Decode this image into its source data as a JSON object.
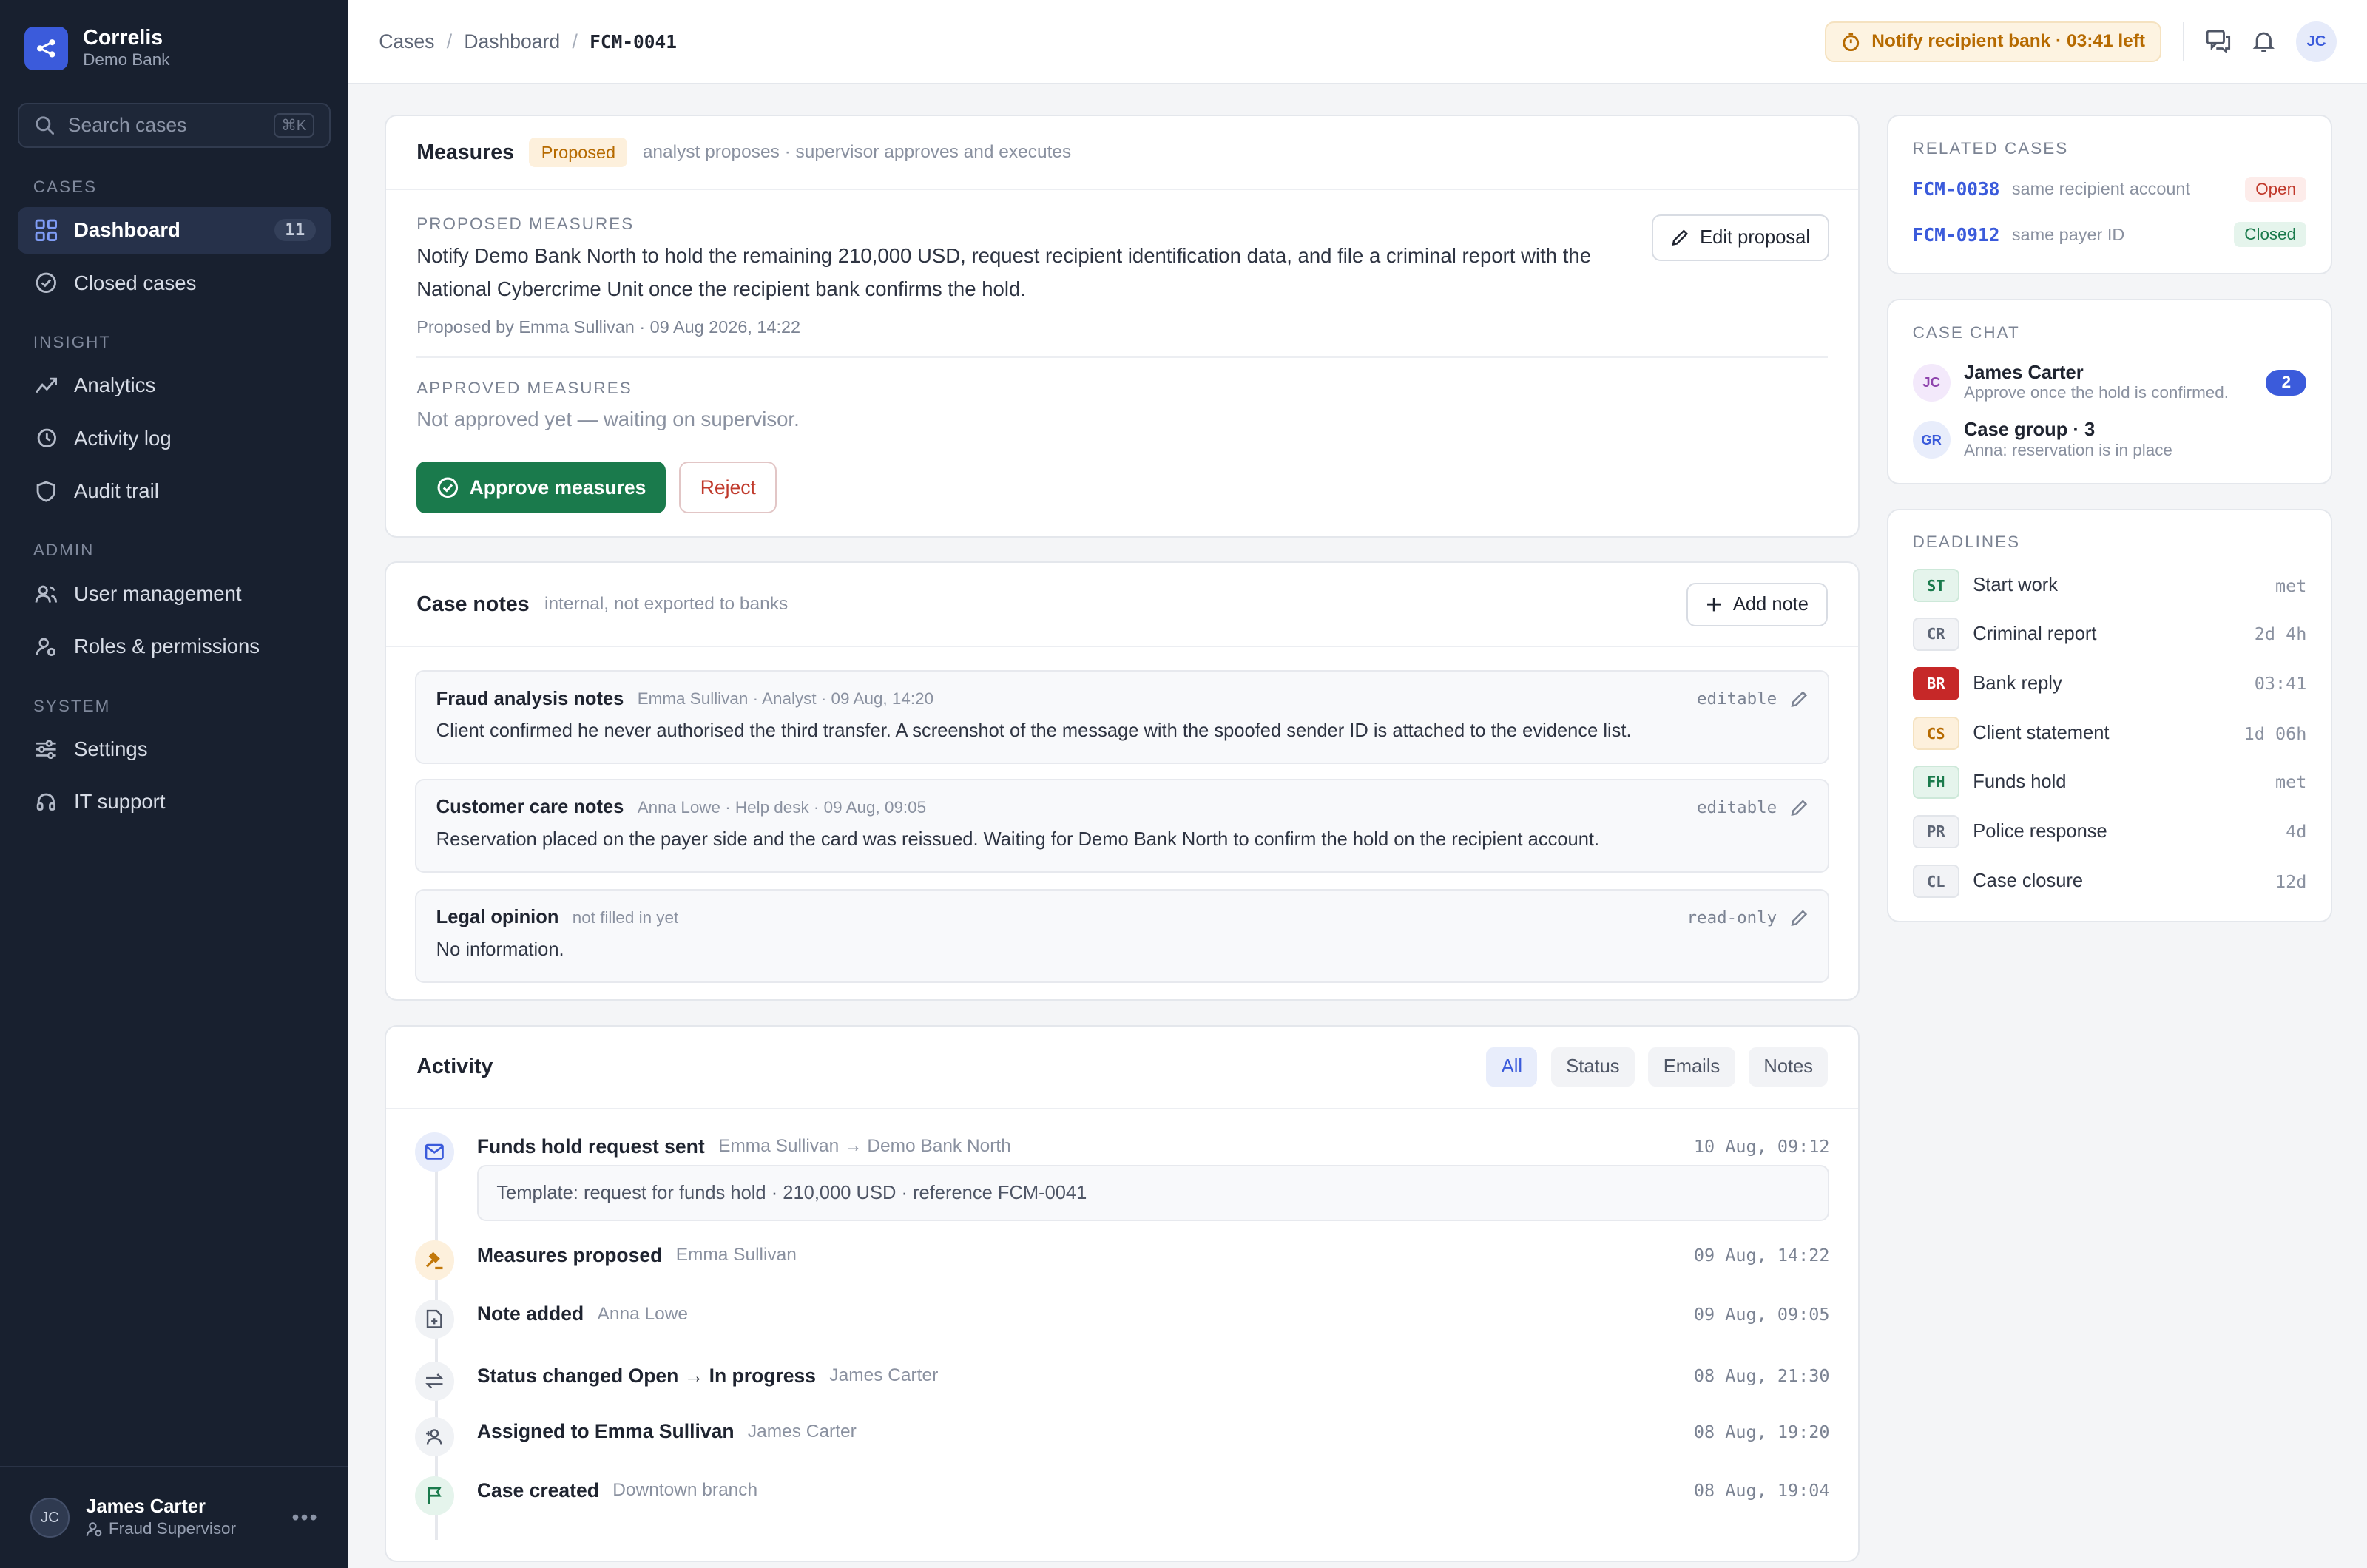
{
  "app": {
    "name": "Correlis",
    "org": "Demo Bank"
  },
  "search": {
    "placeholder": "Search cases",
    "shortcut": "⌘K"
  },
  "sidebar": {
    "sections": {
      "cases": "CASES",
      "insight": "INSIGHT",
      "admin": "ADMIN",
      "system": "SYSTEM"
    },
    "items": [
      {
        "label": "Dashboard",
        "icon": "grid-icon",
        "count": "11",
        "active": true
      },
      {
        "label": "Closed cases",
        "icon": "check-circle-icon"
      },
      {
        "label": "Analytics",
        "icon": "trend-icon"
      },
      {
        "label": "Activity log",
        "icon": "history-icon"
      },
      {
        "label": "Audit trail",
        "icon": "shield-icon"
      },
      {
        "label": "User management",
        "icon": "users-icon"
      },
      {
        "label": "Roles & permissions",
        "icon": "user-key-icon"
      },
      {
        "label": "Settings",
        "icon": "sliders-icon"
      },
      {
        "label": "IT support",
        "icon": "headset-icon"
      }
    ]
  },
  "user": {
    "initials": "JC",
    "name": "James Carter",
    "role": "Fraud Supervisor"
  },
  "header": {
    "breadcrumbs": [
      "Cases",
      "Dashboard",
      "FCM-0041"
    ],
    "timer": "Notify recipient bank · 03:41 left",
    "avatar": "JC"
  },
  "measures": {
    "title": "Measures",
    "badge": "Proposed",
    "subtitle": "analyst proposes · supervisor approves and executes",
    "proposed_label": "PROPOSED MEASURES",
    "proposed_text": "Notify Demo Bank North to hold the remaining 210,000 USD, request recipient identification data, and file a criminal report with the National Cybercrime Unit once the recipient bank confirms the hold.",
    "proposed_by": "Proposed by Emma Sullivan · 09 Aug 2026, 14:22",
    "edit_label": "Edit proposal",
    "approved_label": "APPROVED MEASURES",
    "approved_text": "Not approved yet — waiting on supervisor.",
    "approve_label": "Approve measures",
    "reject_label": "Reject"
  },
  "notes": {
    "title": "Case notes",
    "subtitle": "internal, not exported to banks",
    "add_label": "Add note",
    "items": [
      {
        "title": "Fraud analysis notes",
        "meta": "Emma Sullivan · Analyst · 09 Aug, 14:20",
        "tag": "editable",
        "body": "Client confirmed he never authorised the third transfer. A screenshot of the message with the spoofed sender ID is attached to the evidence list."
      },
      {
        "title": "Customer care notes",
        "meta": "Anna Lowe · Help desk · 09 Aug, 09:05",
        "tag": "editable",
        "body": "Reservation placed on the payer side and the card was reissued. Waiting for Demo Bank North to confirm the hold on the recipient account."
      },
      {
        "title": "Legal opinion",
        "meta": "not filled in yet",
        "tag": "read-only",
        "body": "No information."
      }
    ]
  },
  "activity": {
    "title": "Activity",
    "tabs": [
      "All",
      "Status",
      "Emails",
      "Notes"
    ],
    "events": [
      {
        "title": "Funds hold request sent",
        "who": "Emma Sullivan → Demo Bank North",
        "time": "10 Aug, 09:12",
        "icon": "mail-icon",
        "detail": "Template: request for funds hold · 210,000 USD · reference FCM-0041"
      },
      {
        "title": "Measures proposed",
        "who": "Emma Sullivan",
        "time": "09 Aug, 14:22",
        "icon": "gavel-icon"
      },
      {
        "title": "Note added",
        "who": "Anna Lowe",
        "time": "09 Aug, 09:05",
        "icon": "note-icon"
      },
      {
        "title": "Status changed Open → In progress",
        "who": "James Carter",
        "time": "08 Aug, 21:30",
        "icon": "swap-icon"
      },
      {
        "title": "Assigned to Emma Sullivan",
        "who": "James Carter",
        "time": "08 Aug, 19:20",
        "icon": "user-plus-icon"
      },
      {
        "title": "Case created",
        "who": "Downtown branch",
        "time": "08 Aug, 19:04",
        "icon": "flag-icon"
      }
    ]
  },
  "related": {
    "title": "RELATED CASES",
    "items": [
      {
        "id": "FCM-0038",
        "desc": "same recipient account",
        "status": "Open"
      },
      {
        "id": "FCM-0912",
        "desc": "same payer ID",
        "status": "Closed"
      }
    ]
  },
  "chat": {
    "title": "CASE CHAT",
    "items": [
      {
        "initials": "JC",
        "name": "James Carter",
        "preview": "Approve once the hold is confirmed.",
        "count": "2"
      },
      {
        "initials": "GR",
        "name": "Case group · 3",
        "preview": "Anna: reservation is in place"
      }
    ]
  },
  "deadlines": {
    "title": "DEADLINES",
    "items": [
      {
        "code": "ST",
        "label": "Start work",
        "value": "met"
      },
      {
        "code": "CR",
        "label": "Criminal report",
        "value": "2d 4h"
      },
      {
        "code": "BR",
        "label": "Bank reply",
        "value": "03:41"
      },
      {
        "code": "CS",
        "label": "Client statement",
        "value": "1d 06h"
      },
      {
        "code": "FH",
        "label": "Funds hold",
        "value": "met"
      },
      {
        "code": "PR",
        "label": "Police response",
        "value": "4d"
      },
      {
        "code": "CL",
        "label": "Case closure",
        "value": "12d"
      }
    ]
  },
  "colors": {
    "accent": "#3b5bdb",
    "approve": "#1a7a4c",
    "reject": "#c0392b",
    "warning": "#b66a00",
    "sidebar": "#18202f"
  }
}
